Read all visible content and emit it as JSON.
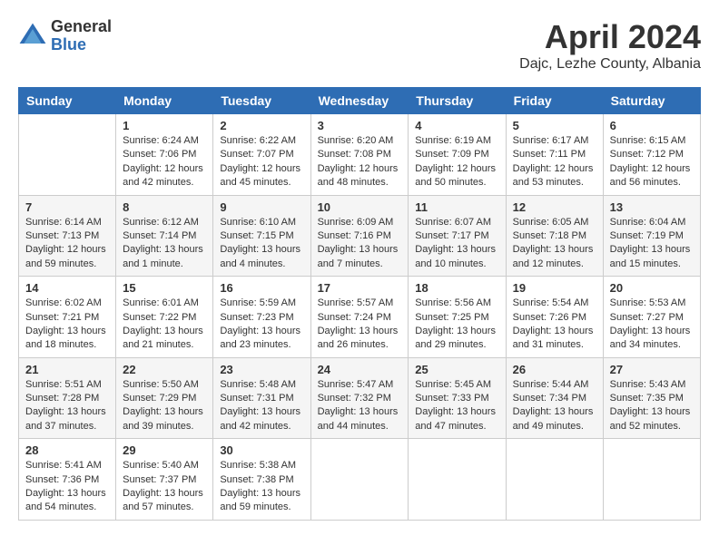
{
  "logo": {
    "general": "General",
    "blue": "Blue"
  },
  "title": "April 2024",
  "location": "Dajc, Lezhe County, Albania",
  "days_header": [
    "Sunday",
    "Monday",
    "Tuesday",
    "Wednesday",
    "Thursday",
    "Friday",
    "Saturday"
  ],
  "weeks": [
    [
      {
        "day": "",
        "info": ""
      },
      {
        "day": "1",
        "info": "Sunrise: 6:24 AM\nSunset: 7:06 PM\nDaylight: 12 hours\nand 42 minutes."
      },
      {
        "day": "2",
        "info": "Sunrise: 6:22 AM\nSunset: 7:07 PM\nDaylight: 12 hours\nand 45 minutes."
      },
      {
        "day": "3",
        "info": "Sunrise: 6:20 AM\nSunset: 7:08 PM\nDaylight: 12 hours\nand 48 minutes."
      },
      {
        "day": "4",
        "info": "Sunrise: 6:19 AM\nSunset: 7:09 PM\nDaylight: 12 hours\nand 50 minutes."
      },
      {
        "day": "5",
        "info": "Sunrise: 6:17 AM\nSunset: 7:11 PM\nDaylight: 12 hours\nand 53 minutes."
      },
      {
        "day": "6",
        "info": "Sunrise: 6:15 AM\nSunset: 7:12 PM\nDaylight: 12 hours\nand 56 minutes."
      }
    ],
    [
      {
        "day": "7",
        "info": "Sunrise: 6:14 AM\nSunset: 7:13 PM\nDaylight: 12 hours\nand 59 minutes."
      },
      {
        "day": "8",
        "info": "Sunrise: 6:12 AM\nSunset: 7:14 PM\nDaylight: 13 hours\nand 1 minute."
      },
      {
        "day": "9",
        "info": "Sunrise: 6:10 AM\nSunset: 7:15 PM\nDaylight: 13 hours\nand 4 minutes."
      },
      {
        "day": "10",
        "info": "Sunrise: 6:09 AM\nSunset: 7:16 PM\nDaylight: 13 hours\nand 7 minutes."
      },
      {
        "day": "11",
        "info": "Sunrise: 6:07 AM\nSunset: 7:17 PM\nDaylight: 13 hours\nand 10 minutes."
      },
      {
        "day": "12",
        "info": "Sunrise: 6:05 AM\nSunset: 7:18 PM\nDaylight: 13 hours\nand 12 minutes."
      },
      {
        "day": "13",
        "info": "Sunrise: 6:04 AM\nSunset: 7:19 PM\nDaylight: 13 hours\nand 15 minutes."
      }
    ],
    [
      {
        "day": "14",
        "info": "Sunrise: 6:02 AM\nSunset: 7:21 PM\nDaylight: 13 hours\nand 18 minutes."
      },
      {
        "day": "15",
        "info": "Sunrise: 6:01 AM\nSunset: 7:22 PM\nDaylight: 13 hours\nand 21 minutes."
      },
      {
        "day": "16",
        "info": "Sunrise: 5:59 AM\nSunset: 7:23 PM\nDaylight: 13 hours\nand 23 minutes."
      },
      {
        "day": "17",
        "info": "Sunrise: 5:57 AM\nSunset: 7:24 PM\nDaylight: 13 hours\nand 26 minutes."
      },
      {
        "day": "18",
        "info": "Sunrise: 5:56 AM\nSunset: 7:25 PM\nDaylight: 13 hours\nand 29 minutes."
      },
      {
        "day": "19",
        "info": "Sunrise: 5:54 AM\nSunset: 7:26 PM\nDaylight: 13 hours\nand 31 minutes."
      },
      {
        "day": "20",
        "info": "Sunrise: 5:53 AM\nSunset: 7:27 PM\nDaylight: 13 hours\nand 34 minutes."
      }
    ],
    [
      {
        "day": "21",
        "info": "Sunrise: 5:51 AM\nSunset: 7:28 PM\nDaylight: 13 hours\nand 37 minutes."
      },
      {
        "day": "22",
        "info": "Sunrise: 5:50 AM\nSunset: 7:29 PM\nDaylight: 13 hours\nand 39 minutes."
      },
      {
        "day": "23",
        "info": "Sunrise: 5:48 AM\nSunset: 7:31 PM\nDaylight: 13 hours\nand 42 minutes."
      },
      {
        "day": "24",
        "info": "Sunrise: 5:47 AM\nSunset: 7:32 PM\nDaylight: 13 hours\nand 44 minutes."
      },
      {
        "day": "25",
        "info": "Sunrise: 5:45 AM\nSunset: 7:33 PM\nDaylight: 13 hours\nand 47 minutes."
      },
      {
        "day": "26",
        "info": "Sunrise: 5:44 AM\nSunset: 7:34 PM\nDaylight: 13 hours\nand 49 minutes."
      },
      {
        "day": "27",
        "info": "Sunrise: 5:43 AM\nSunset: 7:35 PM\nDaylight: 13 hours\nand 52 minutes."
      }
    ],
    [
      {
        "day": "28",
        "info": "Sunrise: 5:41 AM\nSunset: 7:36 PM\nDaylight: 13 hours\nand 54 minutes."
      },
      {
        "day": "29",
        "info": "Sunrise: 5:40 AM\nSunset: 7:37 PM\nDaylight: 13 hours\nand 57 minutes."
      },
      {
        "day": "30",
        "info": "Sunrise: 5:38 AM\nSunset: 7:38 PM\nDaylight: 13 hours\nand 59 minutes."
      },
      {
        "day": "",
        "info": ""
      },
      {
        "day": "",
        "info": ""
      },
      {
        "day": "",
        "info": ""
      },
      {
        "day": "",
        "info": ""
      }
    ]
  ]
}
